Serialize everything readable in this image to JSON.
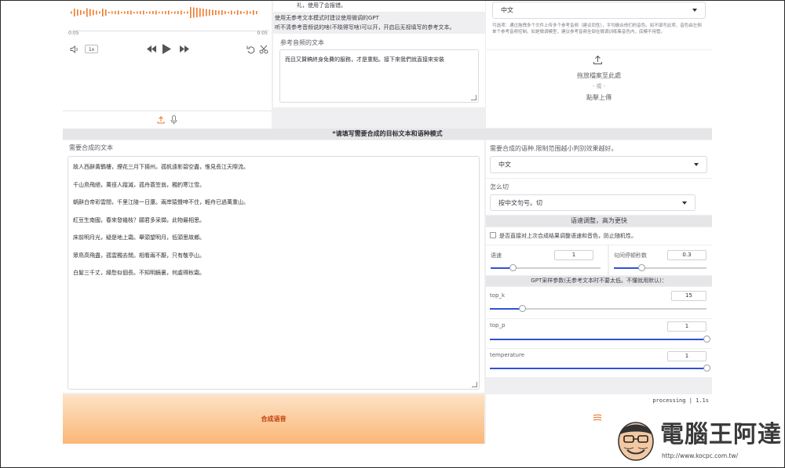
{
  "audio_player": {
    "time_start": "0:05",
    "time_end": "0:05",
    "speed": "1x",
    "wave_color": "#f07a2b"
  },
  "ref_panel": {
    "note_top": "礼，使用了会报错。",
    "hint_line1": "使用无参考文本模式时建议使用微调的GPT",
    "hint_line2": "听不清参考音频说的啥(不晓得写啥)可以开，开启后无视填写的参考文本。",
    "ref_text_label": "参考音频的文本",
    "ref_text_value": "而且又贊稿終身免費的服務，才是重點。接下來我們就直接來安裝"
  },
  "right_top": {
    "lang_value": "中文",
    "optional_note": "可选项：通过拖拽多个文件上传多个参考音频（建议同性），平均融合他们的音色。如不填写此项，音色由左侧单个参考音频控制。如是微调模型，建议参考音频全部在微调训练集音色内，底模不用管。",
    "drop_line1": "拖放檔案至此處",
    "drop_line2": "- 或 -",
    "drop_line3": "點擊上傳"
  },
  "section_header": "*请填写需要合成的目标文本和语种模式",
  "target": {
    "label": "需要合成的文本",
    "lines": [
      "故人西辭黃鶴樓，煙花三月下揚州。孤帆遠影碧空盡，惟見長江天際流。",
      "千山鳥飛絕，萬徑人蹤滅，孤舟蓑笠翁，獨釣寒江雪。",
      "朝辭白帝彩雲間，千里江陵一日還。兩岸猿聲啼不住，輕舟已過萬重山。",
      "紅豆生南國，春來發幾枝？願君多采擷，此物最相思。",
      "床前明月光，疑是地上霜。舉頭望明月，低頭思故鄉。",
      "眾鳥高飛盡，孤雲獨去閒。相看兩不厭，只有敬亭山。",
      "白髮三千丈，緣愁似個長。不知明鏡裏，何處得秋霜。"
    ]
  },
  "settings": {
    "lang_label": "需要合成的语种.限制范围越小判别效果越好。",
    "lang_value": "中文",
    "cut_label": "怎么切",
    "cut_value": "按中文句号。切",
    "speed_header": "语速调整，高为更快",
    "checkbox_label": "是否直接对上次合成结果调整语速和音色，防止随机性。",
    "speed_label": "语速",
    "speed_value": "1",
    "speed_fraction": 0.2,
    "pause_label": "句间停顿秒数",
    "pause_value": "0.3",
    "pause_fraction": 0.3,
    "gpt_header": "GPT采样参数(无参考文本时不要太低。不懂就用默认)：",
    "topk_label": "top_k",
    "topk_value": "15",
    "topk_fraction": 0.15,
    "topp_label": "top_p",
    "topp_value": "1",
    "topp_fraction": 1.0,
    "temp_label": "temperature",
    "temp_value": "1",
    "temp_fraction": 1.0
  },
  "synth_button": "合成语音",
  "status": "processing | 1.1s",
  "watermark": {
    "title": "電腦王阿達",
    "url": "http://www.kocpc.com.tw/"
  }
}
